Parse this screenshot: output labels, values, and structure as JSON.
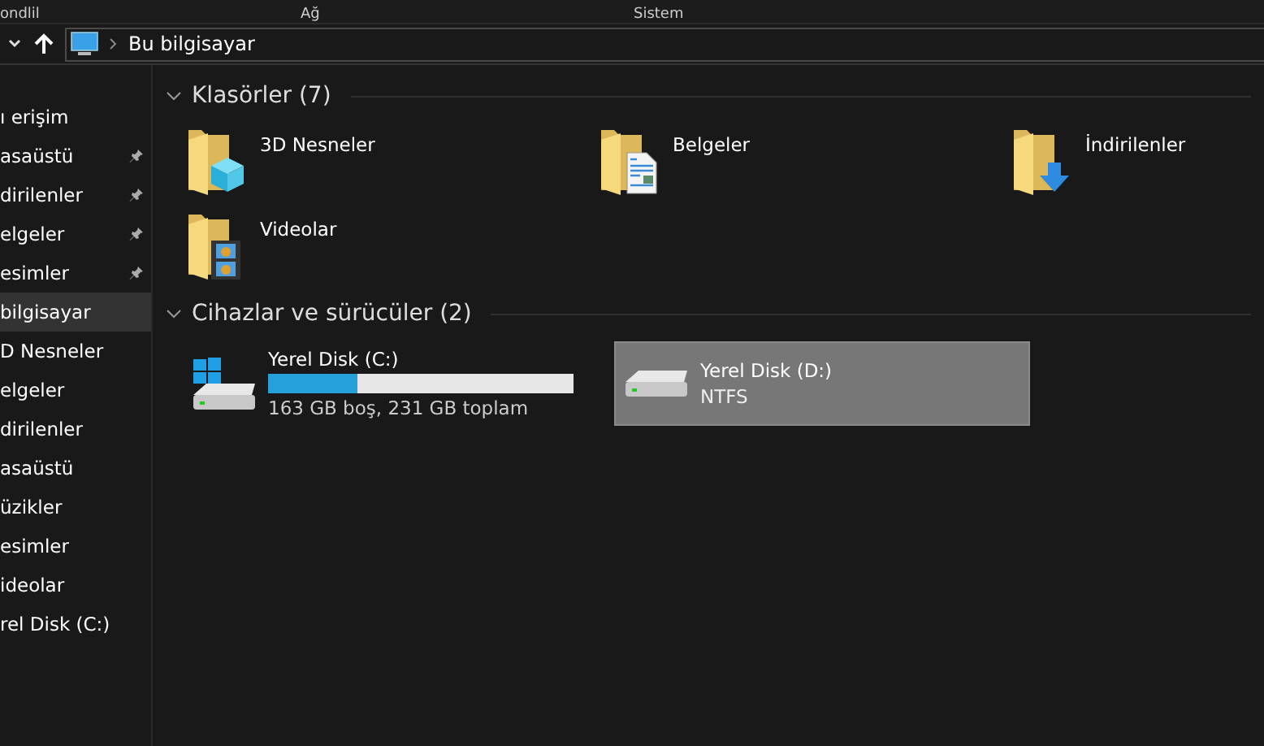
{
  "ribbon_groups": [
    "ondlil",
    "Ağ",
    "Sistem"
  ],
  "address_bar": {
    "path": "Bu bilgisayar"
  },
  "sidebar": {
    "items": [
      {
        "label": "ı erişim",
        "pinned": false,
        "selected": false
      },
      {
        "label": "asaüstü",
        "pinned": true,
        "selected": false
      },
      {
        "label": "dirilenler",
        "pinned": true,
        "selected": false
      },
      {
        "label": "elgeler",
        "pinned": true,
        "selected": false
      },
      {
        "label": "esimler",
        "pinned": true,
        "selected": false
      },
      {
        "label": "bilgisayar",
        "pinned": false,
        "selected": true
      },
      {
        "label": "D Nesneler",
        "pinned": false,
        "selected": false
      },
      {
        "label": "elgeler",
        "pinned": false,
        "selected": false
      },
      {
        "label": "dirilenler",
        "pinned": false,
        "selected": false
      },
      {
        "label": "asaüstü",
        "pinned": false,
        "selected": false
      },
      {
        "label": "üzikler",
        "pinned": false,
        "selected": false
      },
      {
        "label": "esimler",
        "pinned": false,
        "selected": false
      },
      {
        "label": "ideolar",
        "pinned": false,
        "selected": false
      },
      {
        "label": "rel Disk (C:)",
        "pinned": false,
        "selected": false
      }
    ]
  },
  "folders": {
    "title": "Klasörler (7)",
    "items": [
      {
        "name": "3D Nesneler",
        "kind": "cube"
      },
      {
        "name": "Belgeler",
        "kind": "document"
      },
      {
        "name": "İndirilenler",
        "kind": "download"
      },
      {
        "name": "Videolar",
        "kind": "film"
      }
    ]
  },
  "drives": {
    "title": "Cihazlar ve sürücüler (2)",
    "items": [
      {
        "name": "Yerel Disk (C:)",
        "kind": "system",
        "level": 0.29,
        "info": "163 GB boş, 231 GB toplam",
        "selected": false
      },
      {
        "name": "Yerel Disk (D:)",
        "kind": "data",
        "info": "NTFS",
        "selected": true
      }
    ]
  }
}
